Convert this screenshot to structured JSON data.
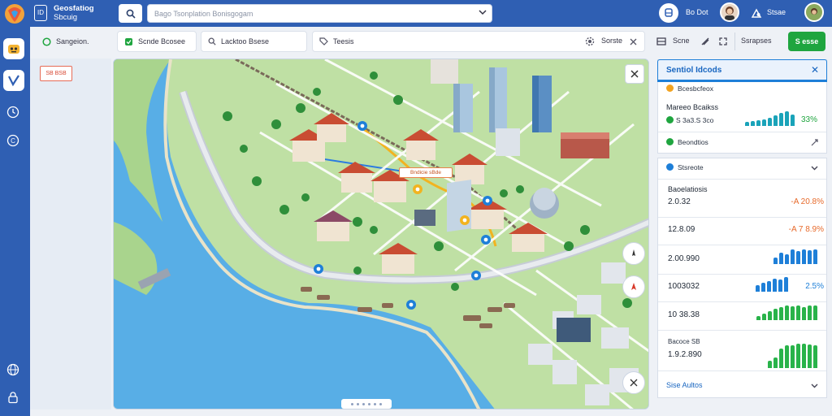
{
  "header": {
    "title_line1": "Geosfatiog",
    "title_line2": "Sbcuig",
    "search_placeholder": "Bago Tsonplation Bonisgogam",
    "user1_label": "Bo Dot",
    "user2_label": "Stsae"
  },
  "toolbar": {
    "chip1": "Sangeion.",
    "chip2": "Scnde Bcosee",
    "chip3": "Lacktoo Bsese",
    "chip4": "Teesis",
    "chip5": "Sorste",
    "text6": "Scne",
    "text7": "Ssrapses",
    "primary_button": "S esse"
  },
  "map": {
    "top_left_label": "SB BSB",
    "callout": "Bndicie sBde"
  },
  "panel": {
    "title": "Sentiol Idcods",
    "item1": "Bcesbcfeox",
    "item2_title": "Mareeo Bcaikss",
    "item2_value": "S 3a3.S 3co",
    "item2_percent": "33%",
    "item3": "Beondtios",
    "section2": "Stsreote",
    "section2_sub": "Baoelatiosis",
    "footer": "Sise Aultos"
  },
  "metrics": [
    {
      "label": "2.0.32",
      "delta": "-A 20.8%",
      "type": "text",
      "color": "#e76a2b"
    },
    {
      "label": "12.8.09",
      "delta": "-A 7 8.9%",
      "type": "text",
      "color": "#e76a2b"
    },
    {
      "label": "2.00.990",
      "delta": "",
      "type": "bars",
      "color": "#1e7fd8",
      "bars": [
        8,
        14,
        12,
        18,
        16,
        18,
        17,
        18
      ]
    },
    {
      "label": "1003032",
      "delta": "2.5%",
      "type": "bars",
      "color": "#1e7fd8",
      "bars": [
        5,
        7,
        8,
        10,
        9,
        11
      ]
    },
    {
      "label": "10 38.38",
      "delta": "",
      "type": "bars",
      "color": "#29b34a",
      "bars": [
        5,
        8,
        11,
        14,
        16,
        18,
        17,
        18,
        16,
        18,
        18
      ]
    },
    {
      "label": "1.9.2.890",
      "delta": "",
      "type": "bars",
      "color": "#29b34a",
      "bars": [
        8,
        12,
        22,
        26,
        26,
        28,
        28,
        27,
        26
      ]
    }
  ],
  "metric5_top": "Bacoce SB",
  "colors": {
    "brand": "#2f5fb3",
    "accent_blue": "#1e7fd8",
    "accent_green": "#1fa53f",
    "warn_orange": "#e76a2b"
  }
}
